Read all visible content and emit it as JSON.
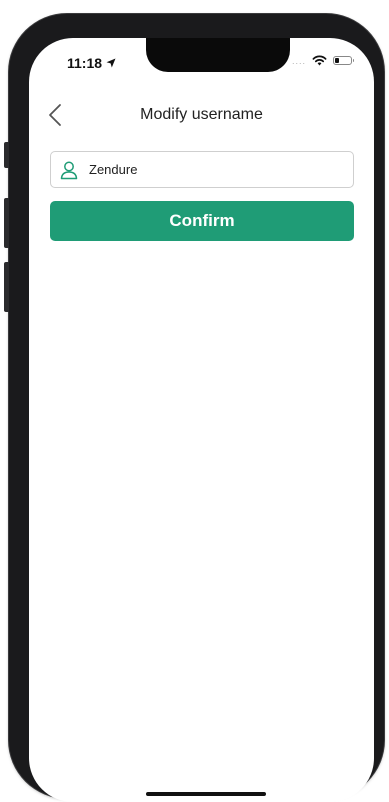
{
  "status_bar": {
    "time": "11:18",
    "location_icon": "location-arrow-icon",
    "signal_dots": "....",
    "wifi_icon": "wifi-icon",
    "battery_icon": "battery-icon"
  },
  "header": {
    "back_icon": "chevron-left-icon",
    "title": "Modify username"
  },
  "form": {
    "username_icon": "user-icon",
    "username_value": "Zendure",
    "confirm_label": "Confirm"
  },
  "colors": {
    "accent": "#1f9c76",
    "icon": "#1f9c76"
  }
}
